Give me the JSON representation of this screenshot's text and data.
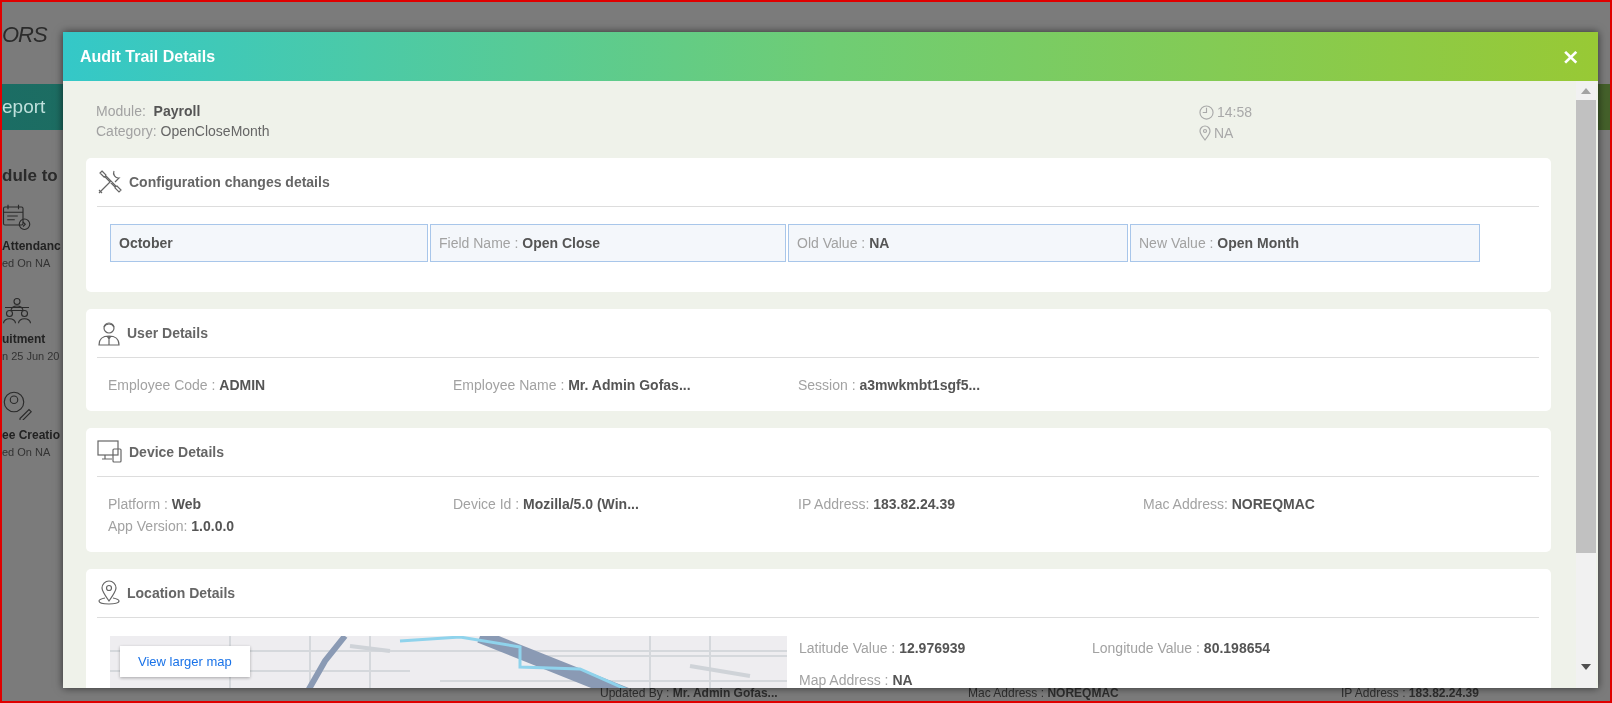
{
  "background": {
    "logo": "ORS",
    "tab": "eport",
    "heading": "dule to",
    "modules": [
      {
        "kind": "calendar",
        "title": "Attendanc",
        "subtitle": "ed On NA"
      },
      {
        "kind": "people",
        "title": "uitment",
        "subtitle": "n 25 Jun 20"
      },
      {
        "kind": "person-edit",
        "title": "ee Creatio",
        "subtitle": "ed On NA"
      }
    ],
    "footer": [
      {
        "label": "Updated By :",
        "value": "Mr. Admin Gofas..."
      },
      {
        "label": "Mac Address :",
        "value": "NOREQMAC"
      },
      {
        "label": "IP Address :",
        "value": "183.82.24.39"
      }
    ]
  },
  "dialog": {
    "title": "Audit Trail Details",
    "close": "×",
    "module": {
      "label": "Module:",
      "value": "Payroll"
    },
    "category": {
      "label": "Category:",
      "value": "OpenCloseMonth"
    },
    "time": "14:58",
    "location": "NA",
    "sections": [
      {
        "kind": "configuration",
        "title": "Configuration changes details",
        "cells": [
          {
            "value": "October"
          },
          {
            "label": "Field Name :",
            "value": "Open Close"
          },
          {
            "label": "Old Value :",
            "value": "NA"
          },
          {
            "label": "New Value :",
            "value": "Open Month"
          }
        ]
      },
      {
        "kind": "user",
        "title": "User Details",
        "fields": [
          {
            "label": "Employee Code :",
            "value": "ADMIN"
          },
          {
            "label": "Employee Name :",
            "value": "Mr. Admin Gofas..."
          },
          {
            "label": "Session :",
            "value": "a3mwkmbt1sgf5..."
          }
        ]
      },
      {
        "kind": "device",
        "title": "Device Details",
        "fields": [
          {
            "label": "Platform :",
            "value": "Web"
          },
          {
            "label": "Device Id :",
            "value": "Mozilla/5.0 (Win..."
          },
          {
            "label": "IP Address:",
            "value": "183.82.24.39"
          },
          {
            "label": "Mac Address:",
            "value": "NOREQMAC"
          },
          {
            "label": "App Version:",
            "value": "1.0.0.0"
          }
        ]
      },
      {
        "kind": "location",
        "title": "Location Details",
        "map_link": "View larger map",
        "fields": [
          {
            "label": "Latitude Value :",
            "value": "12.976939"
          },
          {
            "label": "Longitude Value :",
            "value": "80.198654"
          },
          {
            "label": "Map Address :",
            "value": "NA"
          }
        ]
      }
    ]
  }
}
